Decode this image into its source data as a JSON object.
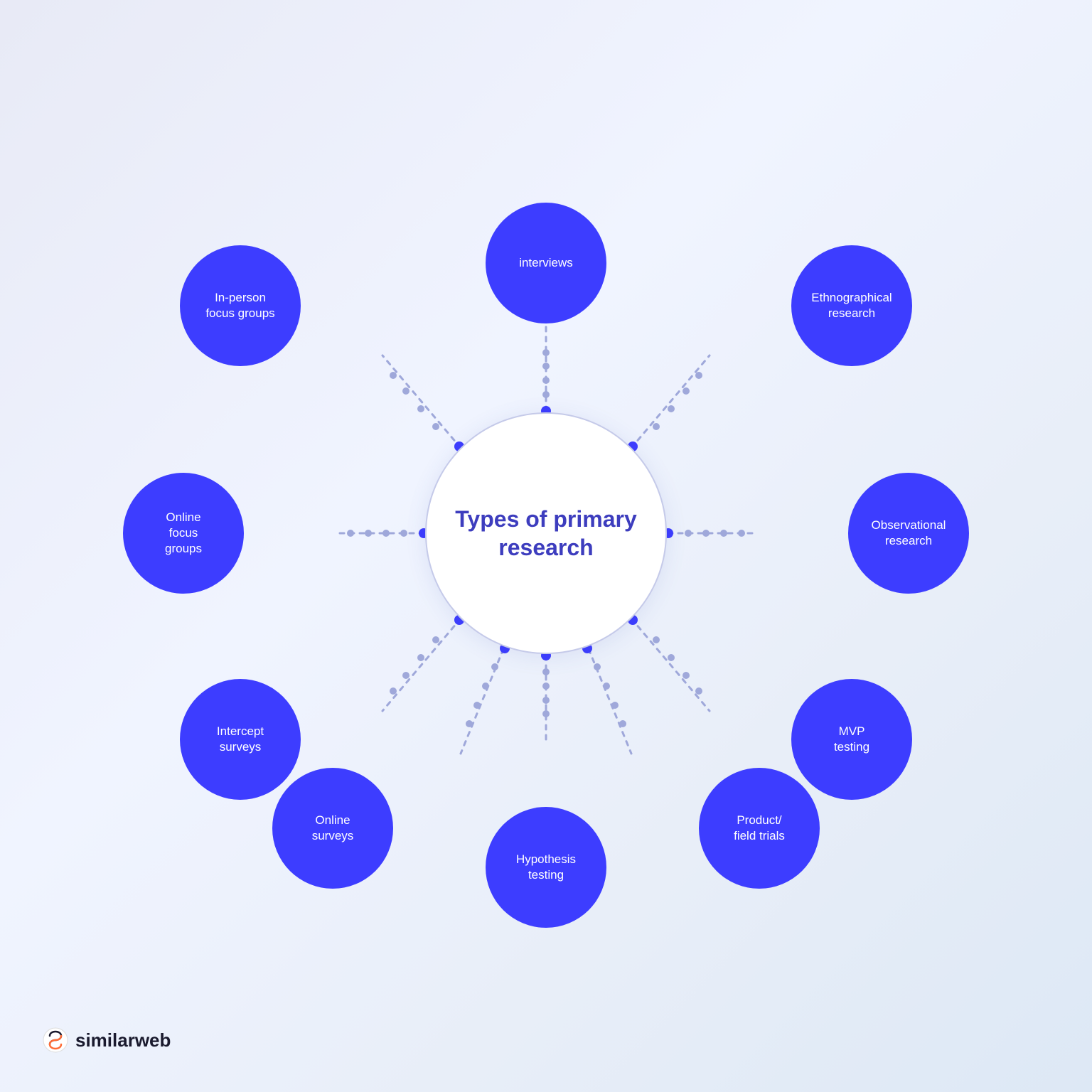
{
  "diagram": {
    "title": "Types of primary research",
    "center_label": "Types of\nprimary\nresearch",
    "satellites": [
      {
        "id": "interviews",
        "label": "interviews",
        "position": "top"
      },
      {
        "id": "ethnographical",
        "label": "Ethnographical\nresearch",
        "position": "top-right"
      },
      {
        "id": "observational",
        "label": "Observational\nresearch",
        "position": "right"
      },
      {
        "id": "mvp",
        "label": "MVP\ntesting",
        "position": "lower-right"
      },
      {
        "id": "product",
        "label": "Product/\nfield trials",
        "position": "bottom-right"
      },
      {
        "id": "hypothesis",
        "label": "Hypothesis\ntesting",
        "position": "bottom"
      },
      {
        "id": "online-surveys",
        "label": "Online\nsurveys",
        "position": "bottom-left"
      },
      {
        "id": "intercept",
        "label": "Intercept\nsurveys",
        "position": "left-lower"
      },
      {
        "id": "online-focus",
        "label": "Online\nfocus\ngroups",
        "position": "left"
      },
      {
        "id": "inperson",
        "label": "In-person\nfocus groups",
        "position": "top-left"
      }
    ],
    "accent_color": "#3d3dff",
    "dot_color": "#9fa8da",
    "center_text_color": "#3333cc"
  },
  "logo": {
    "name": "similarweb",
    "text": "similarweb"
  }
}
